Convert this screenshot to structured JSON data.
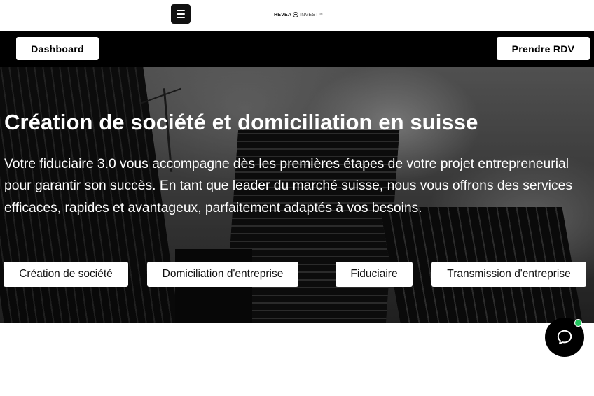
{
  "header": {
    "menu_icon": "hamburger-menu-icon",
    "logo": {
      "brand": "HEVEA",
      "suffix": "INVEST",
      "mark": "®"
    }
  },
  "nav": {
    "dashboard_label": "Dashboard",
    "rdv_label": "Prendre RDV",
    "background": "#000000"
  },
  "hero": {
    "title": "Création de société et domiciliation en suisse",
    "text": "Votre fiduciaire 3.0 vous accompagne dès les premières étapes de votre projet entrepreneurial pour garantir son succès. En tant que leader du marché suisse, nous vous offrons des services efficaces, rapides et avantageux, parfaitement adaptés à vos besoins.",
    "services": [
      {
        "label": "Création de société"
      },
      {
        "label": "Domiciliation d'entreprise"
      },
      {
        "label": "Fiduciaire"
      },
      {
        "label": "Transmission d'entreprise"
      }
    ]
  },
  "chat": {
    "icon": "chat-bubble-icon",
    "status_color": "#22c55e"
  }
}
